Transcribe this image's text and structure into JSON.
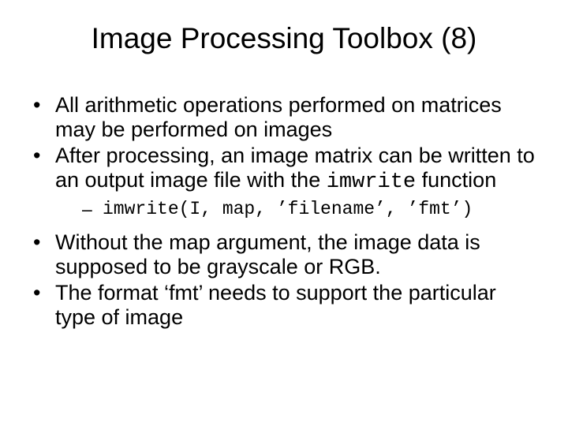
{
  "title": "Image Processing Toolbox (8)",
  "bullets": {
    "b1": "All arithmetic operations performed on matrices may be performed on images",
    "b2a": "After processing, an image matrix can be written to an output image file with the ",
    "b2_code": "imwrite",
    "b2b": " function",
    "b2_sub": "imwrite(I, map, ’filename’, ’fmt’)",
    "b3": "Without the map argument, the image data is supposed to be grayscale or RGB.",
    "b4": "The format ‘fmt’ needs to support the particular type of image"
  }
}
